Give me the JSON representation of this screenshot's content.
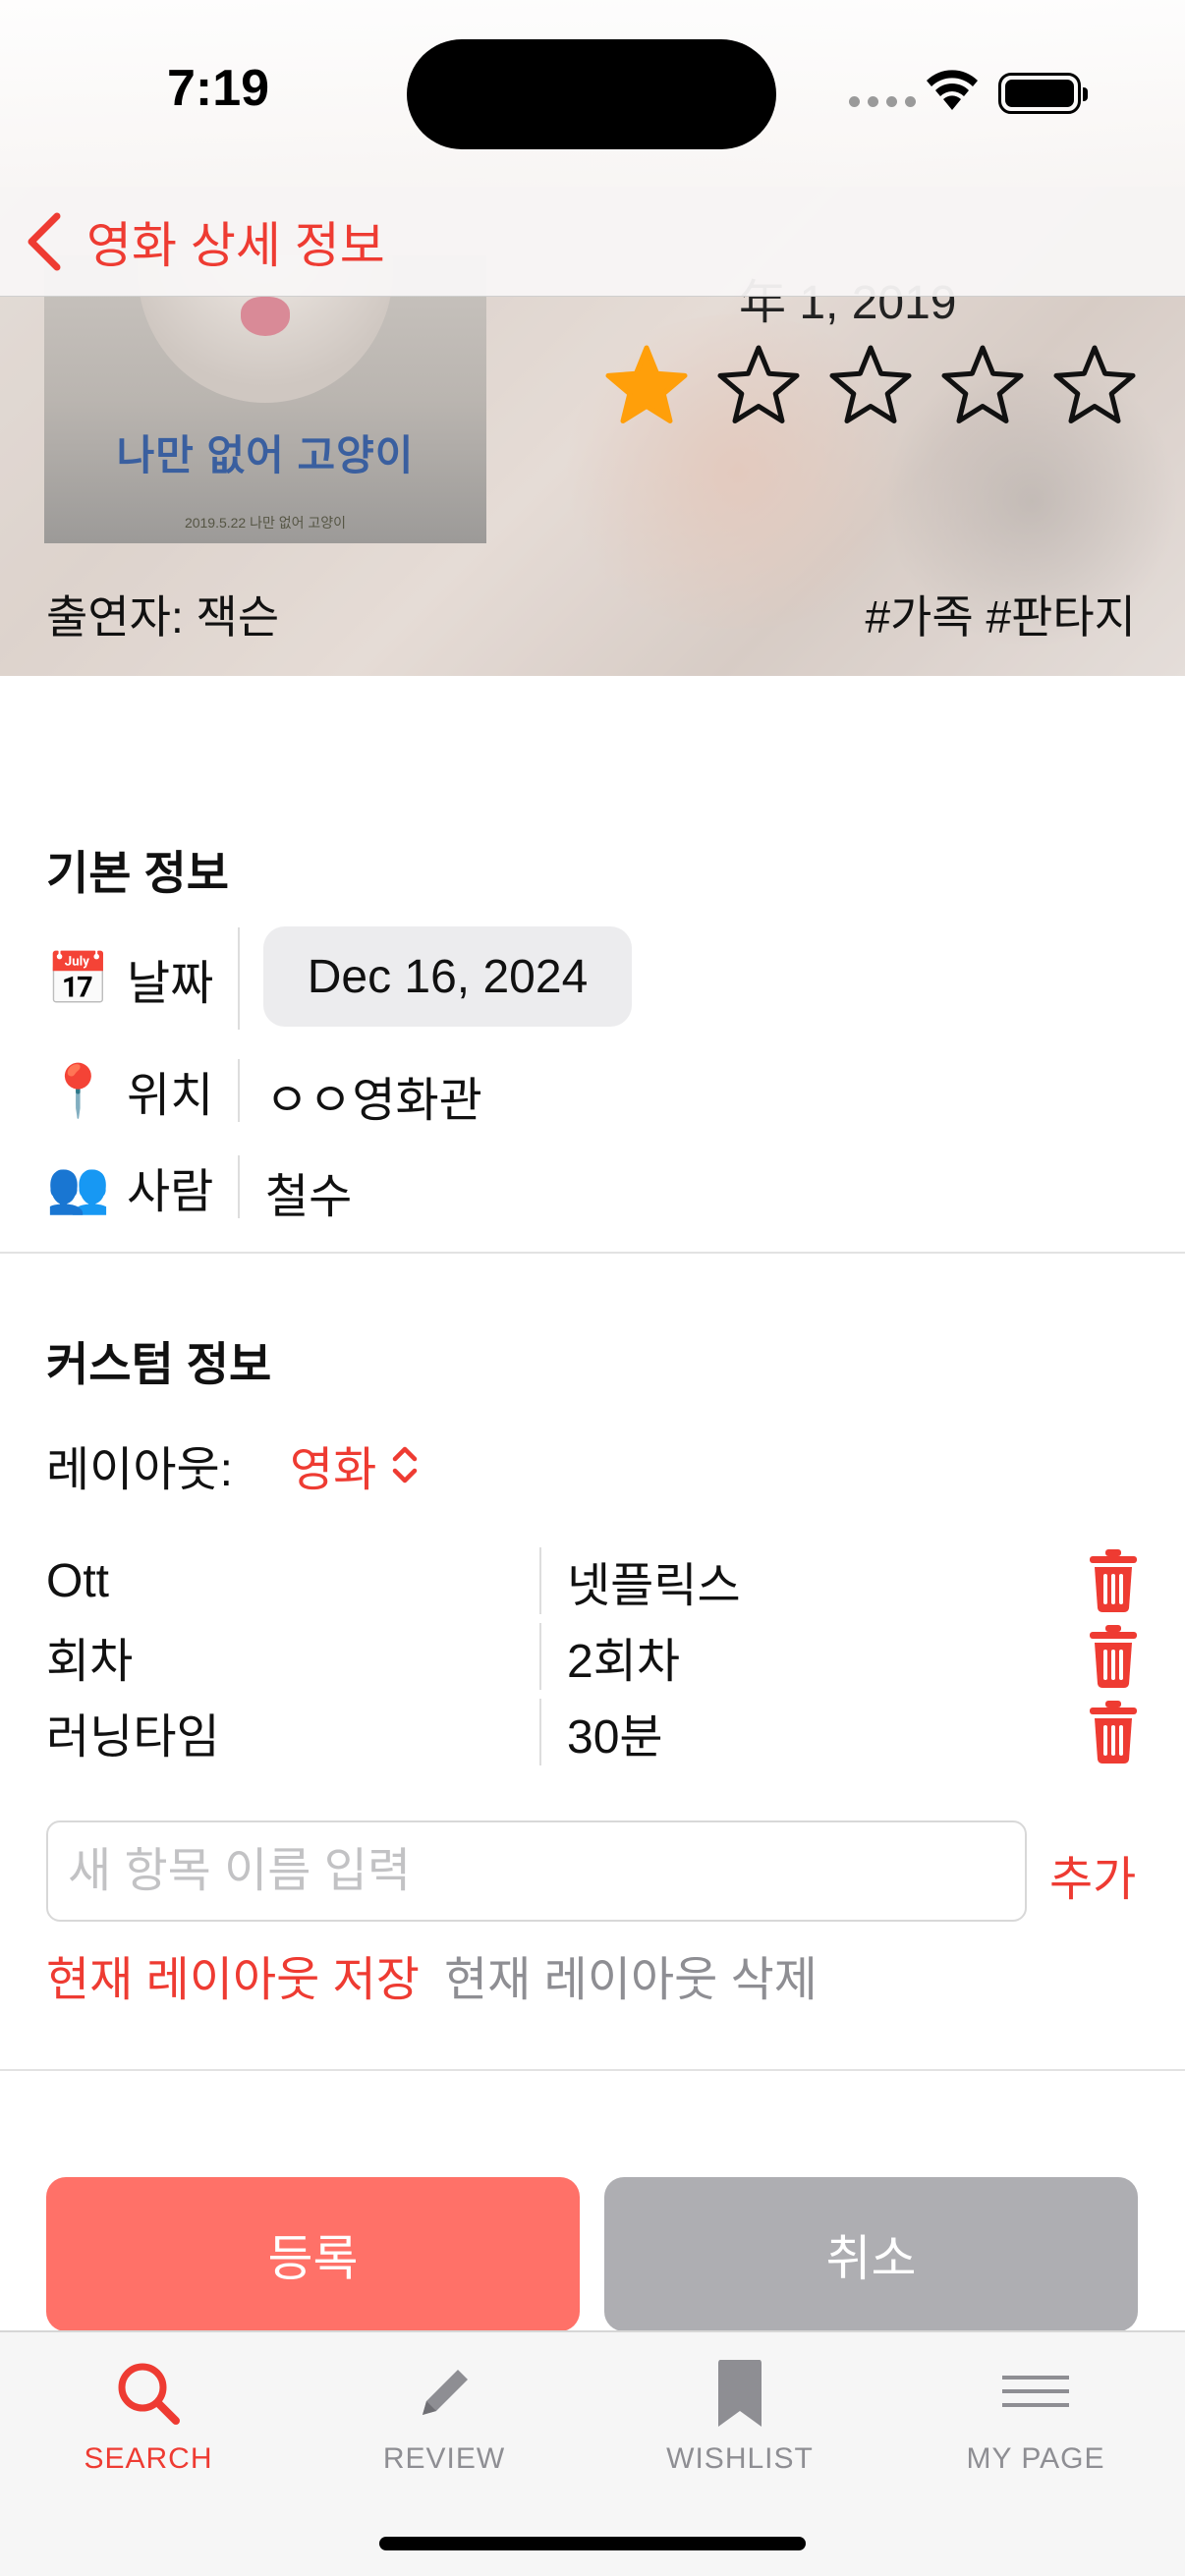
{
  "status_bar": {
    "time": "7:19"
  },
  "nav": {
    "back_label": "영화 상세 정보"
  },
  "movie": {
    "poster_title": "나만 없어 고양이",
    "poster_date": "2019.5.22 나만 없어 고양이",
    "release_date_partial": "年 1, 2019",
    "rating": 1,
    "rating_max": 5,
    "cast": "출연자: 잭슨",
    "tags": "#가족 #판타지"
  },
  "basic_info": {
    "title": "기본 정보",
    "date_label": "날짜",
    "date_value": "Dec 16, 2024",
    "location_label": "위치",
    "location_value": "ㅇㅇ영화관",
    "people_label": "사람",
    "people_value": "철수"
  },
  "custom_info": {
    "title": "커스텀 정보",
    "layout_label": "레이아웃:",
    "layout_value": "영화",
    "fields": [
      {
        "key": "Ott",
        "value": "넷플릭스"
      },
      {
        "key": "회차",
        "value": "2회차"
      },
      {
        "key": "러닝타임",
        "value": "30분"
      }
    ],
    "new_field_placeholder": "새 항목 이름 입력",
    "add_label": "추가",
    "save_layout_label": "현재 레이아웃 저장",
    "delete_layout_label": "현재 레이아웃 삭제"
  },
  "actions": {
    "register_label": "등록",
    "cancel_label": "취소"
  },
  "tabs": [
    {
      "label": "SEARCH",
      "icon": "search-icon",
      "active": true
    },
    {
      "label": "REVIEW",
      "icon": "pencil-icon",
      "active": false
    },
    {
      "label": "WISHLIST",
      "icon": "bookmark-icon",
      "active": false
    },
    {
      "label": "MY PAGE",
      "icon": "menu-icon",
      "active": false
    }
  ],
  "colors": {
    "accent": "#ee3b32",
    "star_filled": "#ff9f0a",
    "register_bg": "#ff7168",
    "cancel_bg": "#aeaeb2"
  }
}
